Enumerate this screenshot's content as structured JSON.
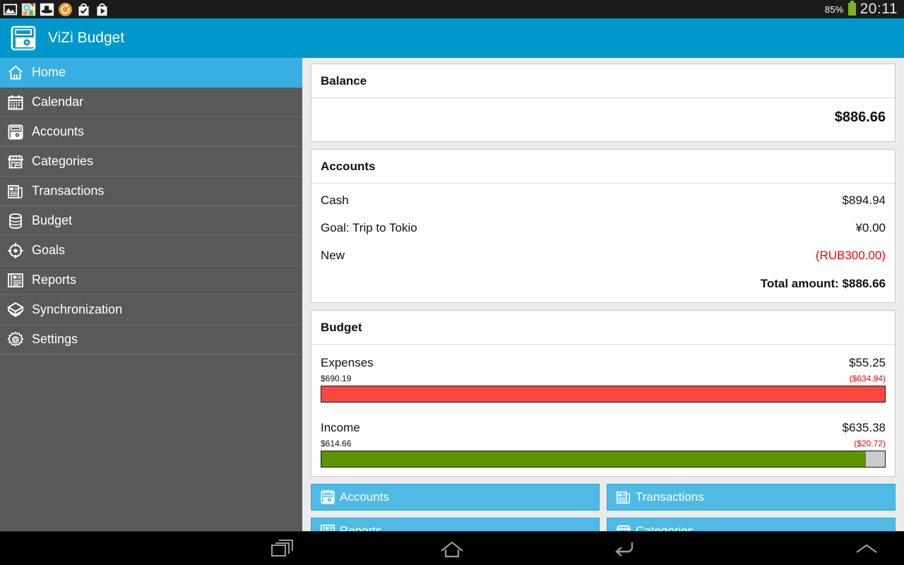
{
  "statusbar": {
    "notifications": [
      "photo-icon",
      "game-app-icon",
      "hat-app-icon",
      "sync-refresh-icon",
      "checkmark-bag-icon",
      "play-bag-icon"
    ],
    "battery_percent": "85%",
    "battery_color": "#7cb518",
    "time": "20:11"
  },
  "appbar": {
    "logo_icon": "wallet-icon",
    "title": "ViZi Budget",
    "background_color": "#0097cd"
  },
  "sidebar": {
    "active_color": "#38afe4",
    "inactive_color": "#58595b",
    "items": [
      {
        "label": "Home",
        "icon": "home-icon",
        "active": true
      },
      {
        "label": "Calendar",
        "icon": "calendar-icon",
        "active": false
      },
      {
        "label": "Accounts",
        "icon": "wallet-icon",
        "active": false
      },
      {
        "label": "Categories",
        "icon": "store-icon",
        "active": false
      },
      {
        "label": "Transactions",
        "icon": "newspaper-icon",
        "active": false
      },
      {
        "label": "Budget",
        "icon": "database-icon",
        "active": false
      },
      {
        "label": "Goals",
        "icon": "target-icon",
        "active": false
      },
      {
        "label": "Reports",
        "icon": "report-icon",
        "active": false
      },
      {
        "label": "Synchronization",
        "icon": "open-box-icon",
        "active": false
      },
      {
        "label": "Settings",
        "icon": "gear-icon",
        "active": false
      }
    ]
  },
  "main": {
    "balance_card": {
      "title": "Balance",
      "amount": "$886.66"
    },
    "accounts_card": {
      "title": "Accounts",
      "rows": [
        {
          "name": "Cash",
          "amount": "$894.94",
          "negative": false
        },
        {
          "name": "Goal: Trip to Tokio",
          "amount": "¥0.00",
          "negative": false
        },
        {
          "name": "New",
          "amount": "(RUB300.00)",
          "negative": true
        }
      ],
      "total": "Total amount: $886.66"
    },
    "budget_card": {
      "title": "Budget",
      "items": [
        {
          "name": "Expenses",
          "amount": "$55.25",
          "spent": "$690.19",
          "over": "($634.94)",
          "fill_percent": 100,
          "bar_color": "#f9483f"
        },
        {
          "name": "Income",
          "amount": "$635.38",
          "spent": "$614.66",
          "over": "($20.72)",
          "fill_percent": 96.6,
          "bar_color": "#5b9400"
        }
      ]
    },
    "quick_buttons": [
      {
        "label": "Accounts",
        "icon": "wallet-icon"
      },
      {
        "label": "Transactions",
        "icon": "newspaper-icon"
      },
      {
        "label": "Reports",
        "icon": "report-icon"
      },
      {
        "label": "Categories",
        "icon": "store-icon"
      }
    ]
  },
  "navbar": {
    "buttons": [
      "recents-icon",
      "home-icon",
      "back-icon",
      "expand-up-icon"
    ]
  }
}
